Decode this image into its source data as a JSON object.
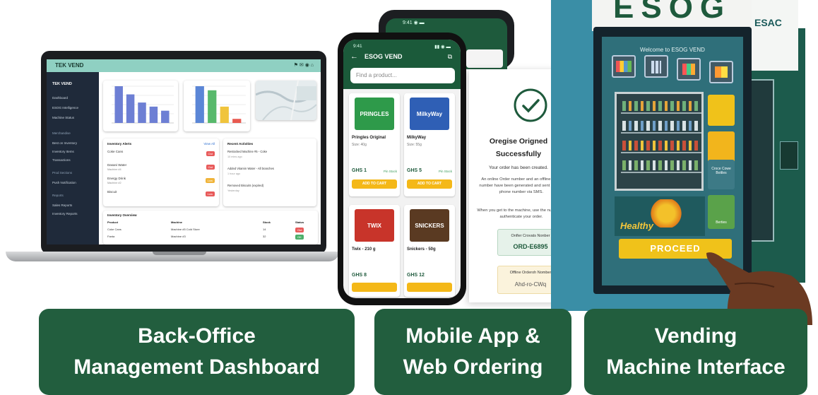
{
  "dashboard": {
    "brand": "TEK VEND",
    "topbar_icons": "⚑ ✉ ◉ ⌂",
    "sidebar": {
      "brand": "TEK VEND",
      "items1": [
        "Dashboard",
        "ESOG Intelligence",
        "Machine Status"
      ],
      "head2": "Merchandise",
      "items2": [
        "Best on Inventory",
        "Inventory Items",
        "Transactions"
      ],
      "head3": "Prod Sections",
      "items3": [
        "Push Notification"
      ],
      "head4": "Reports",
      "items4": [
        "Sales Reports",
        "Inventory Reports"
      ]
    },
    "alerts": {
      "title": "Inventory Alerts",
      "view_all": "View All",
      "rows": [
        {
          "name": "Coke Cans",
          "sub": "",
          "tag": "Out",
          "tag_color": "#e85a5a"
        },
        {
          "name": "Dasani Water",
          "sub": "Machine #4",
          "tag": "Out",
          "tag_color": "#e85a5a"
        },
        {
          "name": "Energy Drink",
          "sub": "Machine #2",
          "tag": "Low",
          "tag_color": "#f0b43a"
        },
        {
          "name": "Biscuit",
          "sub": "",
          "tag": "Low",
          "tag_color": "#e85a5a"
        }
      ]
    },
    "activities": {
      "title": "Recent Activities",
      "rows": [
        {
          "text": "Restocked Machine #5 - Coke",
          "sub": "10 mins ago"
        },
        {
          "text": "Added Vitamin Water - All branches",
          "sub": "1 hour ago"
        },
        {
          "text": "Removed Biscuits (expired)",
          "sub": "Yesterday"
        }
      ]
    },
    "overview": {
      "title": "Inventory Overview",
      "headers": [
        "Product",
        "Machine",
        "Stock",
        "Status"
      ],
      "rows": [
        [
          "Coke Cans",
          "Machine #5 Cold Store",
          "14",
          "Out"
        ],
        [
          "Fanta",
          "Machine #3",
          "32",
          "OK"
        ]
      ]
    }
  },
  "chart1": {
    "type": "bar",
    "values": [
      9,
      7,
      5,
      4,
      3
    ],
    "color": "#6d7fd4"
  },
  "chart2": {
    "type": "bar",
    "values": [
      9,
      8,
      4,
      1
    ],
    "colors": [
      "#5b86d6",
      "#58b96b",
      "#f0c43c",
      "#e85a50"
    ]
  },
  "mobile": {
    "status_left": "9:41",
    "status_right": "▮▮ ◉ ▬",
    "back_status": "9:41 ◉ ▬",
    "title": "ESOG VEND",
    "search_placeholder": "Find a product...",
    "products": [
      {
        "name": "Pringles Original",
        "sub": "Size: 40g",
        "price": "GHS 1",
        "badge": "Pin Stock",
        "button": "ADD TO CART",
        "img": "PRINGLES",
        "img_color": "#2e9a4a"
      },
      {
        "name": "MilkyWay",
        "sub": "Size: 55g",
        "price": "GHS 5",
        "badge": "Pin Stock",
        "button": "ADD TO CART",
        "img": "MilkyWay",
        "img_color": "#2f5fb5"
      },
      {
        "name": "Twix - 210 g",
        "sub": "",
        "price": "GHS 8",
        "badge": "",
        "button": "",
        "img": "TWIX",
        "img_color": "#c8342a"
      },
      {
        "name": "Snickers - 50g",
        "sub": "",
        "price": "GHS 12",
        "badge": "",
        "button": "",
        "img": "SNICKERS",
        "img_color": "#5a3a22"
      }
    ]
  },
  "web": {
    "title_line1": "Oregise Origned",
    "title_line2": "Successfully",
    "created": "Your order has been created.",
    "para1": "An online Order number and an offline order number have been generated and sent to your phone number via SMS.",
    "para2": "When you get to the machine, use the number to authenticate your order.",
    "online_label": "Onfler Crovats Nonber",
    "online_code": "ORD-E6895",
    "offline_label": "Offline Orderoh Nomber",
    "offline_code": "Ahd-ro-CWq"
  },
  "kiosk": {
    "brand_big": "ESOG",
    "brand_small": "ESAC",
    "welcome": "Welcome to ESOG VEND",
    "side_label1": "Croce Cowe Bottles",
    "side_label2": "Berties",
    "promo": "Healthy",
    "proceed": "PROCEED"
  },
  "banners": [
    {
      "line1": "Back-Office",
      "line2": "Management Dashboard"
    },
    {
      "line1": "Mobile App &",
      "line2": "Web Ordering"
    },
    {
      "line1": "Vending",
      "line2": "Machine Interface"
    }
  ]
}
